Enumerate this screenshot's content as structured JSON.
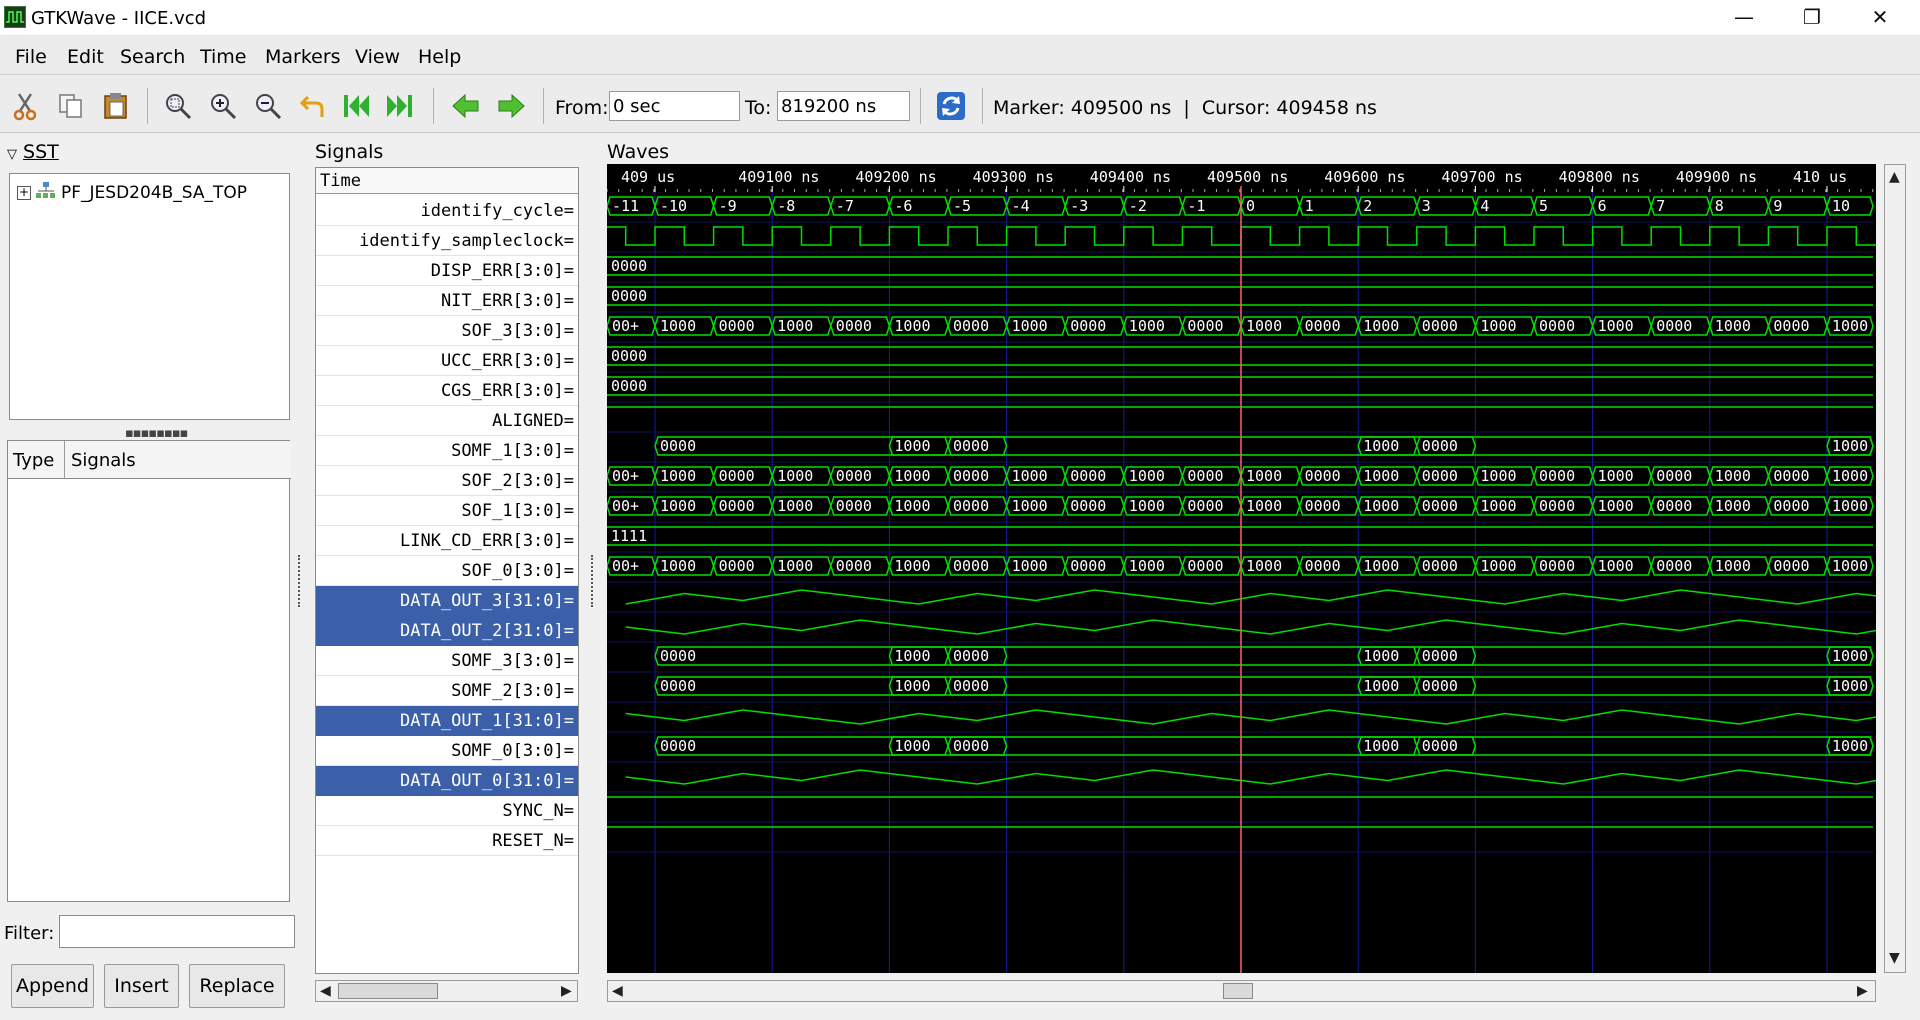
{
  "window": {
    "title": "GTKWave - IICE.vcd",
    "minimize": "—",
    "restore": "❐",
    "close": "✕"
  },
  "menu": [
    "File",
    "Edit",
    "Search",
    "Time",
    "Markers",
    "View",
    "Help"
  ],
  "toolbar": {
    "from_label": "From:",
    "from_value": "0 sec",
    "to_label": "To:",
    "to_value": "819200 ns",
    "status": "Marker: 409500 ns  |  Cursor: 409458 ns"
  },
  "sst": {
    "label": "SST",
    "root": "PF_JESD204B_SA_TOP"
  },
  "type_signals": {
    "type_header": "Type",
    "signals_header": "Signals"
  },
  "filter": {
    "label": "Filter:",
    "value": ""
  },
  "buttons": {
    "append": "Append",
    "insert": "Insert",
    "replace": "Replace"
  },
  "signals_panel": {
    "label": "Signals",
    "time_row": "Time"
  },
  "signals": [
    {
      "name": "identify_cycle=",
      "selected": false,
      "kind": "count"
    },
    {
      "name": "identify_sampleclock=",
      "selected": false,
      "kind": "clock"
    },
    {
      "name": "DISP_ERR[3:0]=",
      "selected": false,
      "kind": "const",
      "value": "0000"
    },
    {
      "name": "NIT_ERR[3:0]=",
      "selected": false,
      "kind": "const",
      "value": "0000"
    },
    {
      "name": "SOF_3[3:0]=",
      "selected": false,
      "kind": "sof"
    },
    {
      "name": "UCC_ERR[3:0]=",
      "selected": false,
      "kind": "const",
      "value": "0000"
    },
    {
      "name": "CGS_ERR[3:0]=",
      "selected": false,
      "kind": "const",
      "value": "0000"
    },
    {
      "name": "ALIGNED=",
      "selected": false,
      "kind": "high"
    },
    {
      "name": "SOMF_1[3:0]=",
      "selected": false,
      "kind": "somf"
    },
    {
      "name": "SOF_2[3:0]=",
      "selected": false,
      "kind": "sof"
    },
    {
      "name": "SOF_1[3:0]=",
      "selected": false,
      "kind": "sof"
    },
    {
      "name": "LINK_CD_ERR[3:0]=",
      "selected": false,
      "kind": "const",
      "value": "1111"
    },
    {
      "name": "SOF_0[3:0]=",
      "selected": false,
      "kind": "sof"
    },
    {
      "name": "DATA_OUT_3[31:0]=",
      "selected": true,
      "kind": "analog"
    },
    {
      "name": "DATA_OUT_2[31:0]=",
      "selected": true,
      "kind": "analog"
    },
    {
      "name": "SOMF_3[3:0]=",
      "selected": false,
      "kind": "somf"
    },
    {
      "name": "SOMF_2[3:0]=",
      "selected": false,
      "kind": "somf"
    },
    {
      "name": "DATA_OUT_1[31:0]=",
      "selected": true,
      "kind": "analog"
    },
    {
      "name": "SOMF_0[3:0]=",
      "selected": false,
      "kind": "somf"
    },
    {
      "name": "DATA_OUT_0[31:0]=",
      "selected": true,
      "kind": "analog"
    },
    {
      "name": "SYNC_N=",
      "selected": false,
      "kind": "high"
    },
    {
      "name": "RESET_N=",
      "selected": false,
      "kind": "high"
    }
  ],
  "waves": {
    "label": "Waves",
    "time_labels": [
      "409 us",
      "409100 ns",
      "409200 ns",
      "409300 ns",
      "409400 ns",
      "409500 ns",
      "409600 ns",
      "409700 ns",
      "409800 ns",
      "409900 ns",
      "410 us"
    ],
    "cycle_values": [
      "-11",
      "-10",
      "-9",
      "-8",
      "-7",
      "-6",
      "-5",
      "-4",
      "-3",
      "-2",
      "-1",
      "0",
      "1",
      "2",
      "3",
      "4",
      "5",
      "6",
      "7",
      "8",
      "9",
      "10"
    ],
    "sof_values": [
      "00+",
      "1000",
      "0000",
      "1000",
      "0000",
      "1000",
      "0000",
      "1000",
      "0000",
      "1000",
      "0000",
      "1000",
      "0000",
      "1000",
      "0000",
      "1000",
      "0000",
      "1000",
      "0000",
      "1000",
      "0000",
      "1000"
    ],
    "somf_values": [
      "0000",
      "1000",
      "0000",
      "1000",
      "0000",
      "1000"
    ],
    "colors": {
      "trace": "#00e000",
      "grid": "#1818a0",
      "marker": "#ff6060",
      "text": "#ffffff"
    }
  }
}
